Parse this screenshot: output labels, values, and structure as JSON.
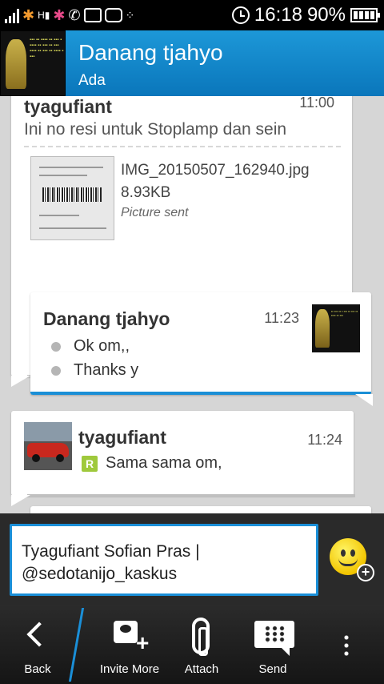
{
  "status_bar": {
    "time": "16:18",
    "battery": "90%",
    "icons": [
      "signal-icon",
      "bbm-flower-icon",
      "hd-signal-icon",
      "bbm-flower-icon",
      "whatsapp-icon",
      "image-icon",
      "bbm-chat-icon",
      "blackberry-icon",
      "alarm-icon",
      "battery-icon"
    ]
  },
  "header": {
    "name": "Danang tjahyo",
    "status": "Ada"
  },
  "messages": [
    {
      "sender": "tyagufiant",
      "time": "11:00",
      "text": "Ini no resi untuk Stoplamp dan sein",
      "attachment": {
        "filename": "IMG_20150507_162940.jpg",
        "size": "8.93KB",
        "status": "Picture sent"
      }
    },
    {
      "sender": "Danang tjahyo",
      "time": "11:23",
      "lines": [
        "Ok om,,",
        "Thanks y"
      ]
    },
    {
      "sender": "tyagufiant",
      "time": "11:24",
      "text": "Sama sama om,",
      "badge": "R"
    }
  ],
  "composer": {
    "line1": "Tyagufiant Sofian Pras |",
    "line2": "@sedotanijo_kaskus"
  },
  "actions": {
    "back": "Back",
    "invite": "Invite More",
    "attach": "Attach",
    "send": "Send"
  },
  "colors": {
    "accent": "#1a8fd8",
    "header": "#0a76bb",
    "chat_bg": "#d6d6d6"
  }
}
